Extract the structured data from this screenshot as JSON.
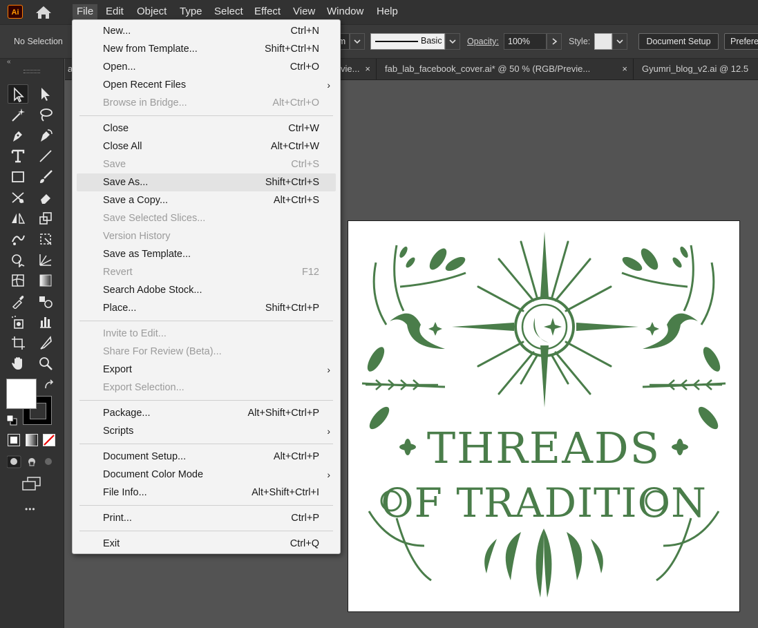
{
  "app": {
    "logo_text": "Ai"
  },
  "menubar": [
    "File",
    "Edit",
    "Object",
    "Type",
    "Select",
    "Effect",
    "View",
    "Window",
    "Help"
  ],
  "controlbar": {
    "selection_status": "No Selection",
    "stroke_unit_partial": "m",
    "brush_style": "Basic",
    "opacity_label": "Opacity:",
    "opacity_value": "100%",
    "style_label": "Style:",
    "document_setup": "Document Setup",
    "preferences_partial": "Prefere"
  },
  "tabs": [
    {
      "title": "a",
      "close": ""
    },
    {
      "title": "vie...",
      "close": "×"
    },
    {
      "title": "fab_lab_facebook_cover.ai* @ 50 % (RGB/Previe...",
      "close": "×"
    },
    {
      "title": "Gyumri_blog_v2.ai @ 12.5",
      "close": ""
    }
  ],
  "toolbar": {
    "collapse": "«",
    "more_tools": "•••"
  },
  "file_menu": {
    "items": [
      {
        "label": "New...",
        "shortcut": "Ctrl+N",
        "enabled": true
      },
      {
        "label": "New from Template...",
        "shortcut": "Shift+Ctrl+N",
        "enabled": true
      },
      {
        "label": "Open...",
        "shortcut": "Ctrl+O",
        "enabled": true
      },
      {
        "label": "Open Recent Files",
        "shortcut": "",
        "enabled": true,
        "submenu": true
      },
      {
        "label": "Browse in Bridge...",
        "shortcut": "Alt+Ctrl+O",
        "enabled": false
      },
      {
        "label": "Close",
        "shortcut": "Ctrl+W",
        "enabled": true
      },
      {
        "label": "Close All",
        "shortcut": "Alt+Ctrl+W",
        "enabled": true
      },
      {
        "label": "Save",
        "shortcut": "Ctrl+S",
        "enabled": false
      },
      {
        "label": "Save As...",
        "shortcut": "Shift+Ctrl+S",
        "enabled": true,
        "highlighted": true
      },
      {
        "label": "Save a Copy...",
        "shortcut": "Alt+Ctrl+S",
        "enabled": true
      },
      {
        "label": "Save Selected Slices...",
        "shortcut": "",
        "enabled": false
      },
      {
        "label": "Version History",
        "shortcut": "",
        "enabled": false
      },
      {
        "label": "Save as Template...",
        "shortcut": "",
        "enabled": true
      },
      {
        "label": "Revert",
        "shortcut": "F12",
        "enabled": false
      },
      {
        "label": "Search Adobe Stock...",
        "shortcut": "",
        "enabled": true
      },
      {
        "label": "Place...",
        "shortcut": "Shift+Ctrl+P",
        "enabled": true
      },
      {
        "label": "Invite to Edit...",
        "shortcut": "",
        "enabled": false
      },
      {
        "label": "Share For Review (Beta)...",
        "shortcut": "",
        "enabled": false
      },
      {
        "label": "Export",
        "shortcut": "",
        "enabled": true,
        "submenu": true
      },
      {
        "label": "Export Selection...",
        "shortcut": "",
        "enabled": false
      },
      {
        "label": "Package...",
        "shortcut": "Alt+Shift+Ctrl+P",
        "enabled": true
      },
      {
        "label": "Scripts",
        "shortcut": "",
        "enabled": true,
        "submenu": true
      },
      {
        "label": "Document Setup...",
        "shortcut": "Alt+Ctrl+P",
        "enabled": true
      },
      {
        "label": "Document Color Mode",
        "shortcut": "",
        "enabled": true,
        "submenu": true
      },
      {
        "label": "File Info...",
        "shortcut": "Alt+Shift+Ctrl+I",
        "enabled": true
      },
      {
        "label": "Print...",
        "shortcut": "Ctrl+P",
        "enabled": true
      },
      {
        "label": "Exit",
        "shortcut": "Ctrl+Q",
        "enabled": true
      }
    ],
    "submenu_glyph": "›"
  },
  "artwork": {
    "line1": "THREADS",
    "line2": "OF TRADITION",
    "color": "#4a7d4a"
  },
  "colors": {
    "menubar": "#323232",
    "canvas": "#535353",
    "menu_bg": "#f3f3f3",
    "menu_hover": "#e3e3e3"
  }
}
